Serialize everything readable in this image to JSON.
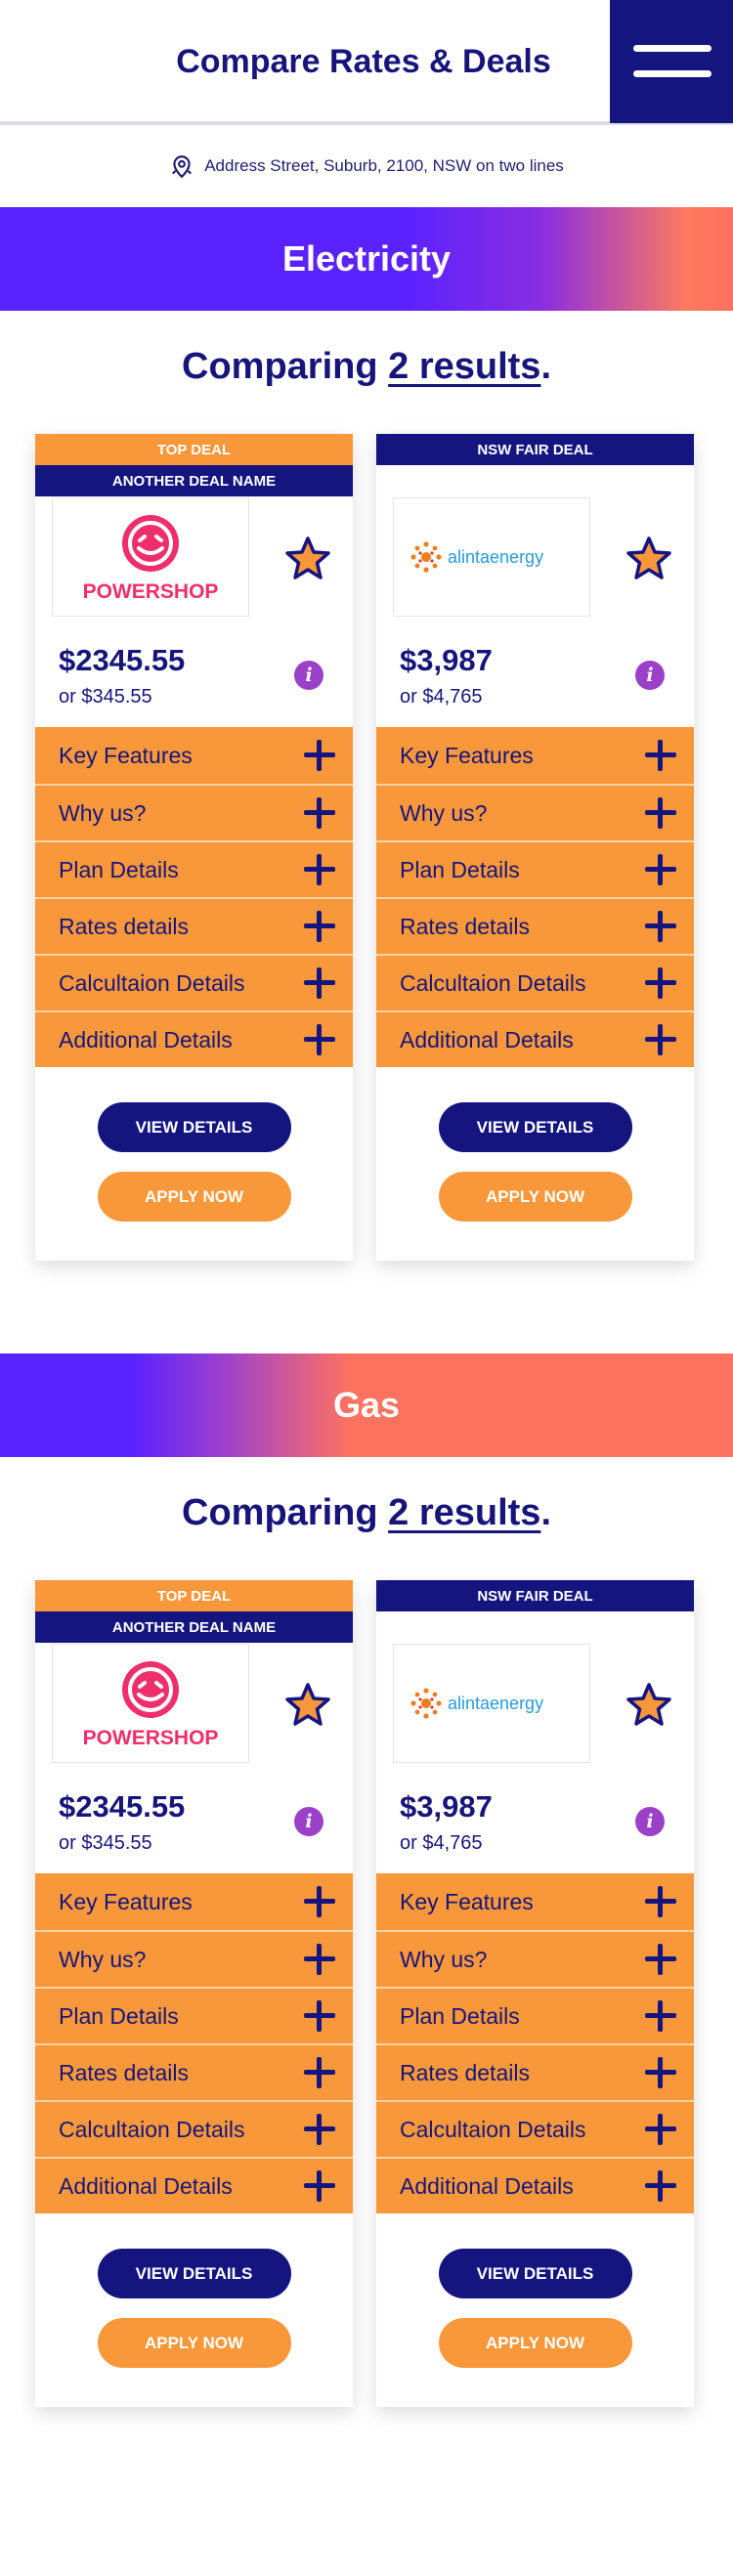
{
  "header": {
    "title": "Compare Rates & Deals",
    "menu_icon": "hamburger-menu-icon"
  },
  "address": {
    "icon": "location-pin-icon",
    "text": "Address Street, Suburb, 2100, NSW on two lines"
  },
  "colors": {
    "navy": "#15157f",
    "orange": "#f8983a",
    "purple": "#5a22ff",
    "coral": "#ff725f",
    "info": "#9b40c8"
  },
  "sections": [
    {
      "banner": "Electricity",
      "comparing_prefix": "Comparing ",
      "comparing_count": "2 results",
      "comparing_suffix": ".",
      "cards": [
        {
          "tag": "TOP DEAL",
          "deal_name": "ANOTHER DEAL NAME",
          "logo_text": "POWERSHOP",
          "price": "$2345.55",
          "price_sub": "or $345.55"
        },
        {
          "tag": "NSW FAIR DEAL",
          "deal_name": "",
          "logo_text": "alintaenergy",
          "price": "$3,987",
          "price_sub": "or $4,765"
        }
      ]
    },
    {
      "banner": "Gas",
      "comparing_prefix": "Comparing ",
      "comparing_count": "2 results",
      "comparing_suffix": ".",
      "cards": [
        {
          "tag": "TOP DEAL",
          "deal_name": "ANOTHER DEAL NAME",
          "logo_text": "POWERSHOP",
          "price": "$2345.55",
          "price_sub": "or $345.55"
        },
        {
          "tag": "NSW FAIR DEAL",
          "deal_name": "",
          "logo_text": "alintaenergy",
          "price": "$3,987",
          "price_sub": "or $4,765"
        }
      ]
    }
  ],
  "accordion": [
    "Key Features",
    "Why us?",
    "Plan Details",
    "Rates details",
    "Calcultaion Details",
    "Additional Details"
  ],
  "buttons": {
    "view": "VIEW DETAILS",
    "apply": "APPLY NOW"
  }
}
